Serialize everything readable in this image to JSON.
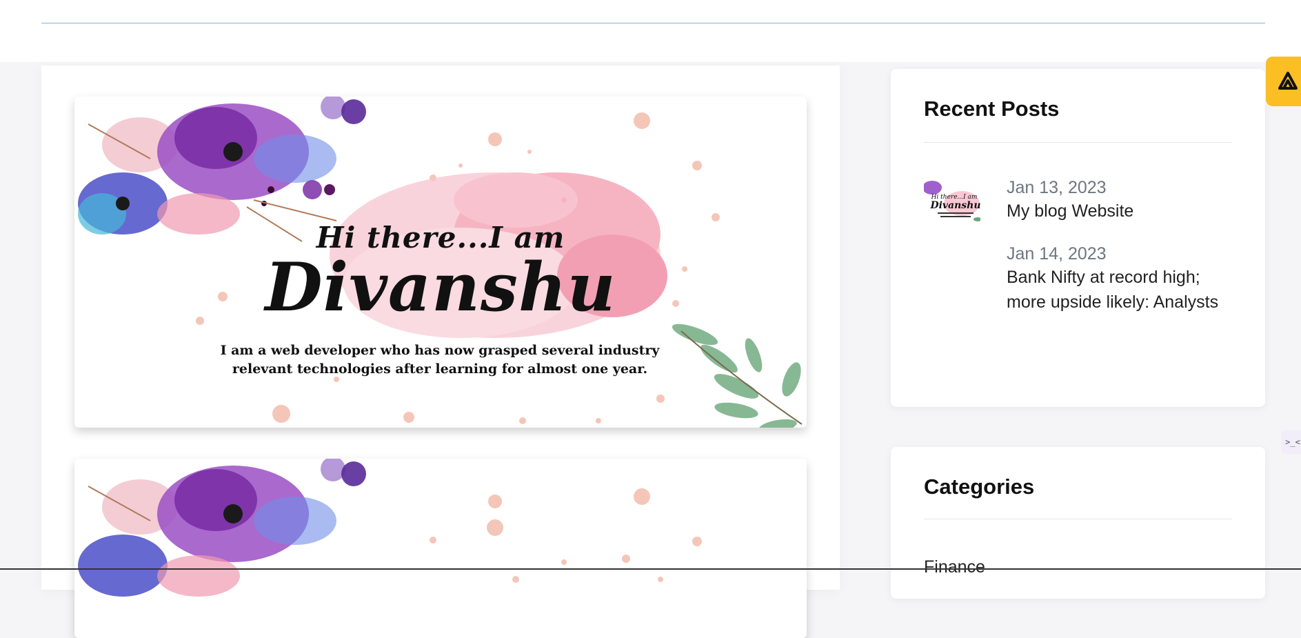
{
  "posts": [
    {
      "banner_greeting": "Hi there...I am",
      "banner_name": "Divanshu",
      "banner_text": "I am a web developer who has now grasped several industry relevant technologies after learning for almost one year."
    },
    {
      "banner_greeting": "",
      "banner_name": "",
      "banner_text": ""
    }
  ],
  "recent_posts": {
    "title": "Recent Posts",
    "items": [
      {
        "date": "Jan 13, 2023",
        "title": "My blog Website"
      },
      {
        "date": "Jan 14, 2023",
        "title": "Bank Nifty at record high; more upside likely: Analysts"
      }
    ]
  },
  "categories": {
    "title": "Categories",
    "items": [
      "Finance"
    ]
  },
  "widget": {
    "fab_icon": "arrow-triangle-icon",
    "mini_tab_glyph": ">_<"
  },
  "colors": {
    "accent": "#fbbf24",
    "rule": "#7fb4e4"
  }
}
